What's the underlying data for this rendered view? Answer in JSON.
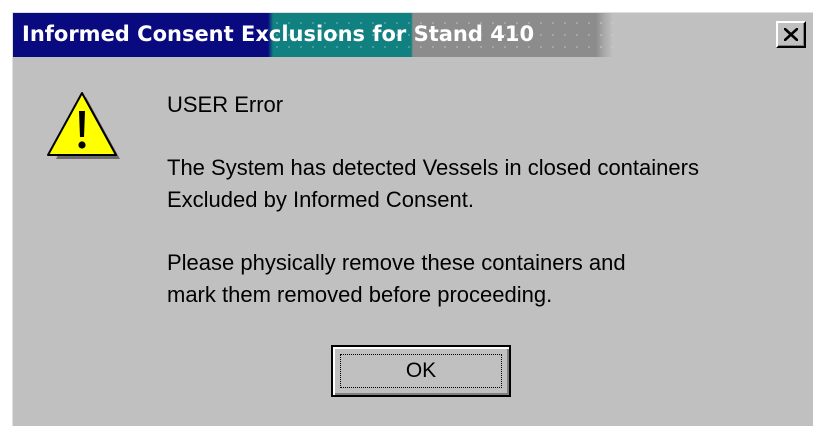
{
  "window": {
    "title": "Informed Consent Exclusions for Stand 410",
    "close_icon": "close-x-icon"
  },
  "message": {
    "icon": "warning-icon",
    "heading": "USER Error",
    "line1": "The System has detected Vessels in closed containers",
    "line2": "Excluded by Informed Consent.",
    "line3": "Please physically remove these containers and",
    "line4": "mark them removed before proceeding."
  },
  "buttons": {
    "ok_label": "OK"
  },
  "colors": {
    "title_bar_start": "#0a0a80",
    "title_bar_end": "#c0c0c0",
    "dialog_face": "#c0c0c0",
    "warning_yellow": "#ffff00"
  }
}
